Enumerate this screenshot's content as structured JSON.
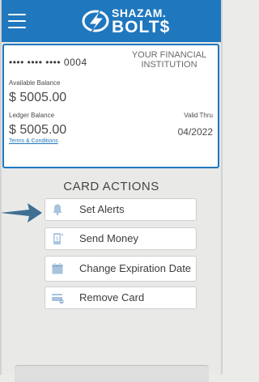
{
  "header": {
    "logo_top": "SHAZAM.",
    "logo_bottom": "BOLT$"
  },
  "card": {
    "masked_number": "•••• •••• •••• 0004",
    "institution": "YOUR FINANCIAL INSTITUTION",
    "available_balance_label": "Available Balance",
    "available_balance": "$ 5005.00",
    "ledger_balance_label": "Ledger Balance",
    "ledger_balance": "$ 5005.00",
    "valid_thru_label": "Valid Thru",
    "valid_thru": "04/2022",
    "terms_link": "Terms & Conditions"
  },
  "card_actions": {
    "title": "CARD ACTIONS",
    "items": [
      {
        "label": "Set Alerts",
        "icon": "bell-icon"
      },
      {
        "label": "Send Money",
        "icon": "send-money-icon"
      },
      {
        "label": "Change Expiration Date",
        "icon": "calendar-icon"
      },
      {
        "label": "Remove Card",
        "icon": "remove-card-icon"
      }
    ]
  },
  "colors": {
    "brand_blue": "#1f77be",
    "icon_blue": "#a8c3dd",
    "arrow_blue": "#3f6f93"
  }
}
